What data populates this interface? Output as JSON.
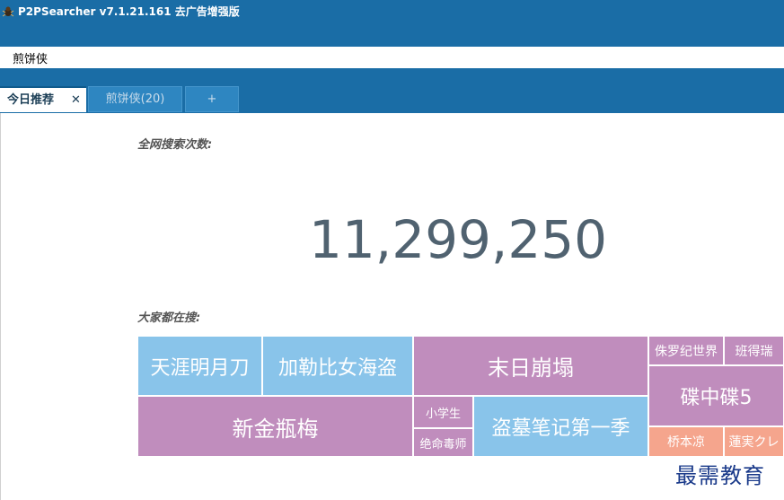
{
  "app": {
    "title": "P2PSearcher v7.1.21.161 去广告增强版",
    "icon": "spider-icon"
  },
  "search": {
    "value": "煎饼侠"
  },
  "tabs": [
    {
      "label": "今日推荐",
      "close_symbol": "✕",
      "active": true
    },
    {
      "label": "煎饼侠(20)",
      "active": false
    },
    {
      "label": "+",
      "active": false
    }
  ],
  "stats": {
    "total_label": "全网搜索次数:",
    "total_value": "11,299,250",
    "popular_label": "大家都在搜:"
  },
  "colors": {
    "blue": "#89c4ea",
    "purple": "#c08dbd",
    "salmon": "#f5a58d",
    "header": "#1a6da6"
  },
  "treemap": [
    {
      "label": "天涯明月刀",
      "color": "blue"
    },
    {
      "label": "加勒比女海盗",
      "color": "blue"
    },
    {
      "label": "末日崩塌",
      "color": "purple"
    },
    {
      "label": "侏罗纪世界",
      "color": "purple"
    },
    {
      "label": "班得瑞",
      "color": "purple"
    },
    {
      "label": "新金瓶梅",
      "color": "purple"
    },
    {
      "label": "小学生",
      "color": "purple"
    },
    {
      "label": "绝命毒师",
      "color": "purple"
    },
    {
      "label": "盗墓笔记第一季",
      "color": "blue"
    },
    {
      "label": "碟中碟5",
      "color": "purple"
    },
    {
      "label": "桥本凉",
      "color": "salmon"
    },
    {
      "label": "蓮実クレ",
      "color": "salmon"
    }
  ],
  "watermark": "最需教育"
}
